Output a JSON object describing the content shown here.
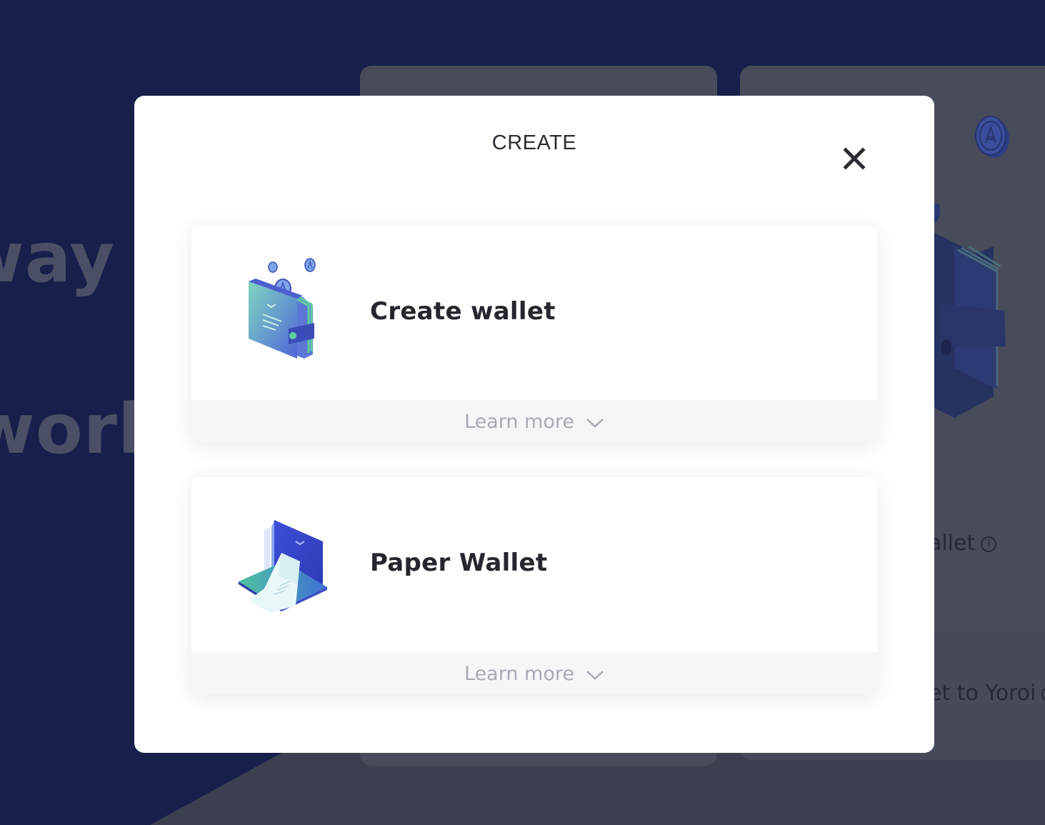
{
  "background": {
    "headline_line1": "way",
    "headline_line2": "world",
    "card_text_1": "allet",
    "card_text_2": "et to Yoroi",
    "info_glyph": "i"
  },
  "modal": {
    "title": "CREATE",
    "close_icon": "close-icon",
    "options": [
      {
        "label": "Create wallet",
        "icon": "wallet-icon",
        "learn_more": "Learn more",
        "learn_more_icon": "chevron-down-icon"
      },
      {
        "label": "Paper Wallet",
        "icon": "paper-wallet-icon",
        "learn_more": "Learn more",
        "learn_more_icon": "chevron-down-icon"
      }
    ]
  },
  "colors": {
    "page_background": "#171f4a",
    "overlay_gray": "#3b3f50",
    "modal_background": "#ffffff",
    "title_text": "#2b2c32",
    "learn_more_text": "#a8abb6",
    "learn_more_background": "#f5f6f8",
    "accent_blue": "#3f4ed6",
    "accent_green": "#4fc3a1"
  }
}
